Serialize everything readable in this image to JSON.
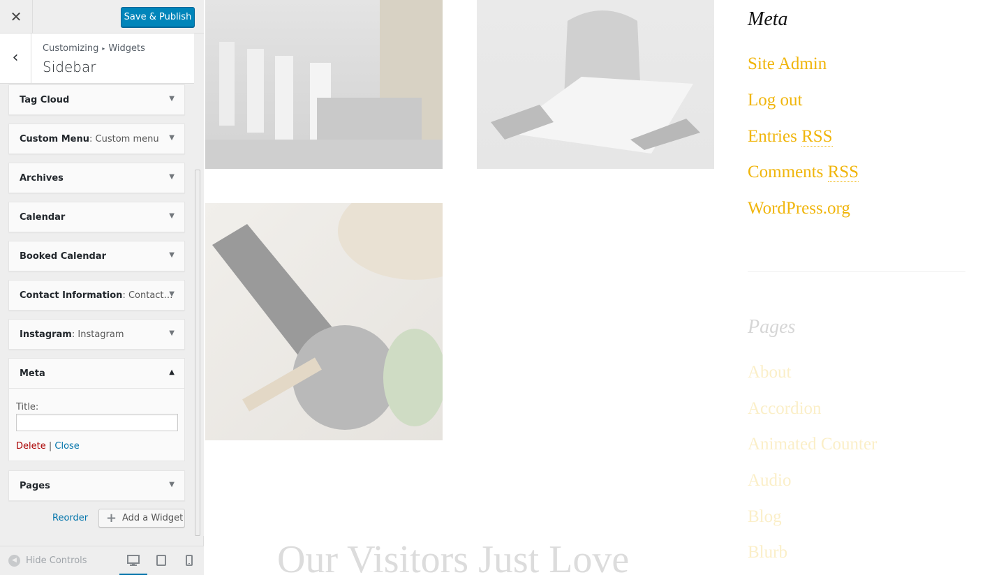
{
  "customizer": {
    "close_glyph": "✕",
    "publish_label": "Save & Publish",
    "back_glyph": "‹",
    "breadcrumb": {
      "root": "Customizing",
      "separator": "▸",
      "section": "Widgets"
    },
    "section_title": "Sidebar",
    "widgets": [
      {
        "title": "Tag Cloud",
        "subtitle": ""
      },
      {
        "title": "Custom Menu",
        "subtitle": ": Custom menu"
      },
      {
        "title": "Archives",
        "subtitle": ""
      },
      {
        "title": "Calendar",
        "subtitle": ""
      },
      {
        "title": "Booked Calendar",
        "subtitle": ""
      },
      {
        "title": "Contact Information",
        "subtitle": ": Contact…"
      },
      {
        "title": "Instagram",
        "subtitle": ": Instagram"
      }
    ],
    "collapsed_arrow": "▼",
    "expanded_arrow": "▲",
    "meta_widget": {
      "title": "Meta",
      "field_label": "Title:",
      "field_value": "",
      "delete_label": "Delete",
      "separator": "|",
      "close_label": "Close"
    },
    "pages_widget": {
      "title": "Pages"
    },
    "reorder_label": "Reorder",
    "add_widget_label": "Add a Widget",
    "add_widget_icon": "+",
    "hide_controls_label": "Hide Controls",
    "hide_controls_icon": "◀",
    "device_icons": {
      "desktop": "desktop-icon",
      "tablet": "tablet-icon",
      "mobile": "mobile-icon"
    }
  },
  "preview": {
    "meta_heading": "Meta",
    "meta_links": [
      {
        "text": "Site Admin",
        "abbr": ""
      },
      {
        "text": "Log out",
        "abbr": ""
      },
      {
        "text": "Entries ",
        "abbr": "RSS"
      },
      {
        "text": "Comments ",
        "abbr": "RSS"
      },
      {
        "text": "WordPress.org",
        "abbr": ""
      }
    ],
    "pages_heading": "Pages",
    "page_links": [
      "About",
      "Accordion",
      "Animated Counter",
      "Audio",
      "Blog",
      "Blurb"
    ],
    "visitors_text": "Our Visitors Just Love",
    "colors": {
      "link": "#f0b50b",
      "publish": "#0085ba",
      "delete": "#aa0000",
      "wp_link": "#0073aa"
    }
  }
}
